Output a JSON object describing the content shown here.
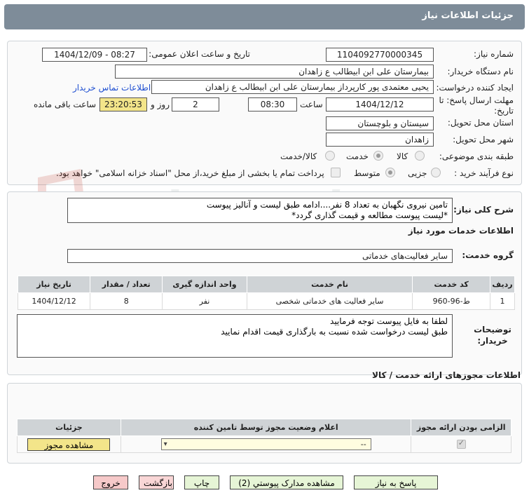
{
  "header": {
    "title": "جزئیات اطلاعات نیاز"
  },
  "form": {
    "need_number_label": "شماره نیاز:",
    "need_number": "1104092770000345",
    "announce_label": "تاریخ و ساعت اعلان عمومی:",
    "announce_value": "1404/12/09 - 08:27",
    "buyer_org_label": "نام دستگاه خریدار:",
    "buyer_org": "بیمارستان علی ابن ابیطالب  ع  زاهدان",
    "creator_label": "ایجاد کننده درخواست:",
    "creator": "یحیی معتمدی پور کارپرداز بیمارستان علی ابن ابیطالب  ع  زاهدان",
    "contact_link": "اطلاعات تماس خریدار",
    "deadline_label": "مهلت ارسال پاسخ: تا تاریخ:",
    "deadline_date": "1404/12/12",
    "hour_label": "ساعت",
    "deadline_hour": "08:30",
    "days": "2",
    "days_label": "روز و",
    "remaining_time": "23:20:53",
    "remaining_label": "ساعت باقی مانده",
    "province_label": "استان محل تحویل:",
    "province": "سیستان و بلوچستان",
    "city_label": "شهر محل تحویل:",
    "city": "زاهدان",
    "category_label": "طبقه بندی موضوعی:",
    "category_goods": "کالا",
    "category_service": "خدمت",
    "category_both": "کالا/خدمت",
    "process_label": "نوع فرآیند خرید :",
    "process_partial": "جزیی",
    "process_medium": "متوسط",
    "process_note": "پرداخت تمام یا بخشی از مبلغ خرید،از محل \"اسناد خزانه اسلامی\" خواهد بود."
  },
  "description": {
    "label": "شرح کلی نیاز:",
    "text": "تامین نیروی نگهبان به تعداد 8 نفر....ادامه طبق لیست و آنالیز پیوست\n*لیست پیوست مطالعه و قیمت گذاری گردد*"
  },
  "services": {
    "section_title": "اطلاعات خدمات مورد نیاز",
    "group_label": "گروه خدمت:",
    "group_value": "سایر فعالیت‌های خدماتی",
    "columns": [
      "ردیف",
      "کد خدمت",
      "نام خدمت",
      "واحد اندازه گیری",
      "تعداد / مقدار",
      "تاریخ نیاز"
    ],
    "rows": [
      [
        "1",
        "ط-96-960",
        "سایر فعالیت های خدماتی شخصی",
        "نفر",
        "8",
        "1404/12/12"
      ]
    ]
  },
  "buyer_notes": {
    "label": "توضیحات خریدار:",
    "text": "لطفا به فایل پیوست توجه فرمایید\nطبق لیست درخواست شده نسبت به بارگذاری قیمت اقدام نمایید"
  },
  "permits": {
    "section_title": "اطلاعات مجوزهای ارائه خدمت / کالا",
    "columns": [
      "الزامی بودن ارائه مجوز",
      "اعلام وضعیت مجوز توسط تامین کننده",
      "جزئیات"
    ],
    "select_value": "--",
    "view_button": "مشاهده مجوز"
  },
  "actions": {
    "reply": "پاسخ به نیاز",
    "attachments": "مشاهده مدارک پیوستي (2)",
    "print": "چاپ",
    "back": "بازگشت",
    "exit": "خروج"
  },
  "colors": {
    "header_bg": "#7e8c99",
    "time_highlight": "#f3e58a",
    "link": "#1f4fd1",
    "back_btn_bg": "#f9d6d6",
    "exit_btn_bg": "#f6c9c9",
    "action_btn_bg": "#e6f5d6"
  }
}
